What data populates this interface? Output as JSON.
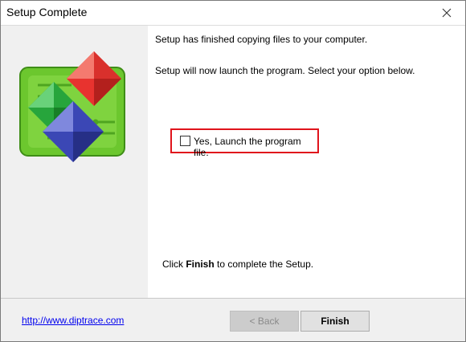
{
  "window": {
    "title": "Setup Complete",
    "close_icon": "close-icon"
  },
  "content": {
    "line1": "Setup has finished copying files to your computer.",
    "line2": "Setup will now launch the program. Select your option below.",
    "launch_option": {
      "label": "Yes, Launch the program file.",
      "checked": false
    },
    "finish_prefix": "Click ",
    "finish_bold": "Finish",
    "finish_suffix": " to complete the Setup."
  },
  "footer": {
    "link": "http://www.diptrace.com",
    "back_label": "< Back",
    "finish_label": "Finish"
  },
  "colors": {
    "highlight_border": "#e0141c",
    "logo_green": "#6cc72e",
    "gem_red": "#e8332f",
    "gem_green": "#27a53c",
    "gem_blue": "#3b47b5"
  }
}
